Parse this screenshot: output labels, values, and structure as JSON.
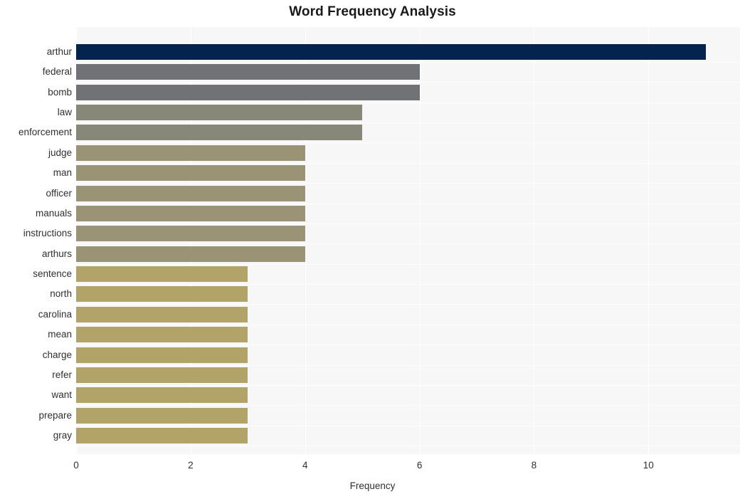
{
  "chart_data": {
    "type": "bar",
    "orientation": "horizontal",
    "title": "Word Frequency Analysis",
    "xlabel": "Frequency",
    "ylabel": "",
    "categories": [
      "arthur",
      "federal",
      "bomb",
      "law",
      "enforcement",
      "judge",
      "man",
      "officer",
      "manuals",
      "instructions",
      "arthurs",
      "sentence",
      "north",
      "carolina",
      "mean",
      "charge",
      "refer",
      "want",
      "prepare",
      "gray"
    ],
    "values": [
      11,
      6,
      6,
      5,
      5,
      4,
      4,
      4,
      4,
      4,
      4,
      3,
      3,
      3,
      3,
      3,
      3,
      3,
      3,
      3
    ],
    "bar_colors": [
      "#04244f",
      "#717276",
      "#717276",
      "#878878",
      "#878878",
      "#9a9375",
      "#9a9375",
      "#9a9375",
      "#9a9375",
      "#9a9375",
      "#9a9375",
      "#b2a468",
      "#b2a468",
      "#b2a468",
      "#b2a468",
      "#b2a468",
      "#b2a468",
      "#b2a468",
      "#b2a468",
      "#b2a468"
    ],
    "xlim": [
      0,
      11.6
    ],
    "xticks": [
      0,
      2,
      4,
      6,
      8,
      10
    ],
    "xtick_labels": [
      "0",
      "2",
      "4",
      "6",
      "8",
      "10"
    ],
    "grid": true,
    "grid_color": "#ffffff",
    "plot_background": "#f7f7f8",
    "figure_background": "#ffffff",
    "legend": null,
    "text_color": "#303030",
    "title_color": "#1a1a1a"
  }
}
